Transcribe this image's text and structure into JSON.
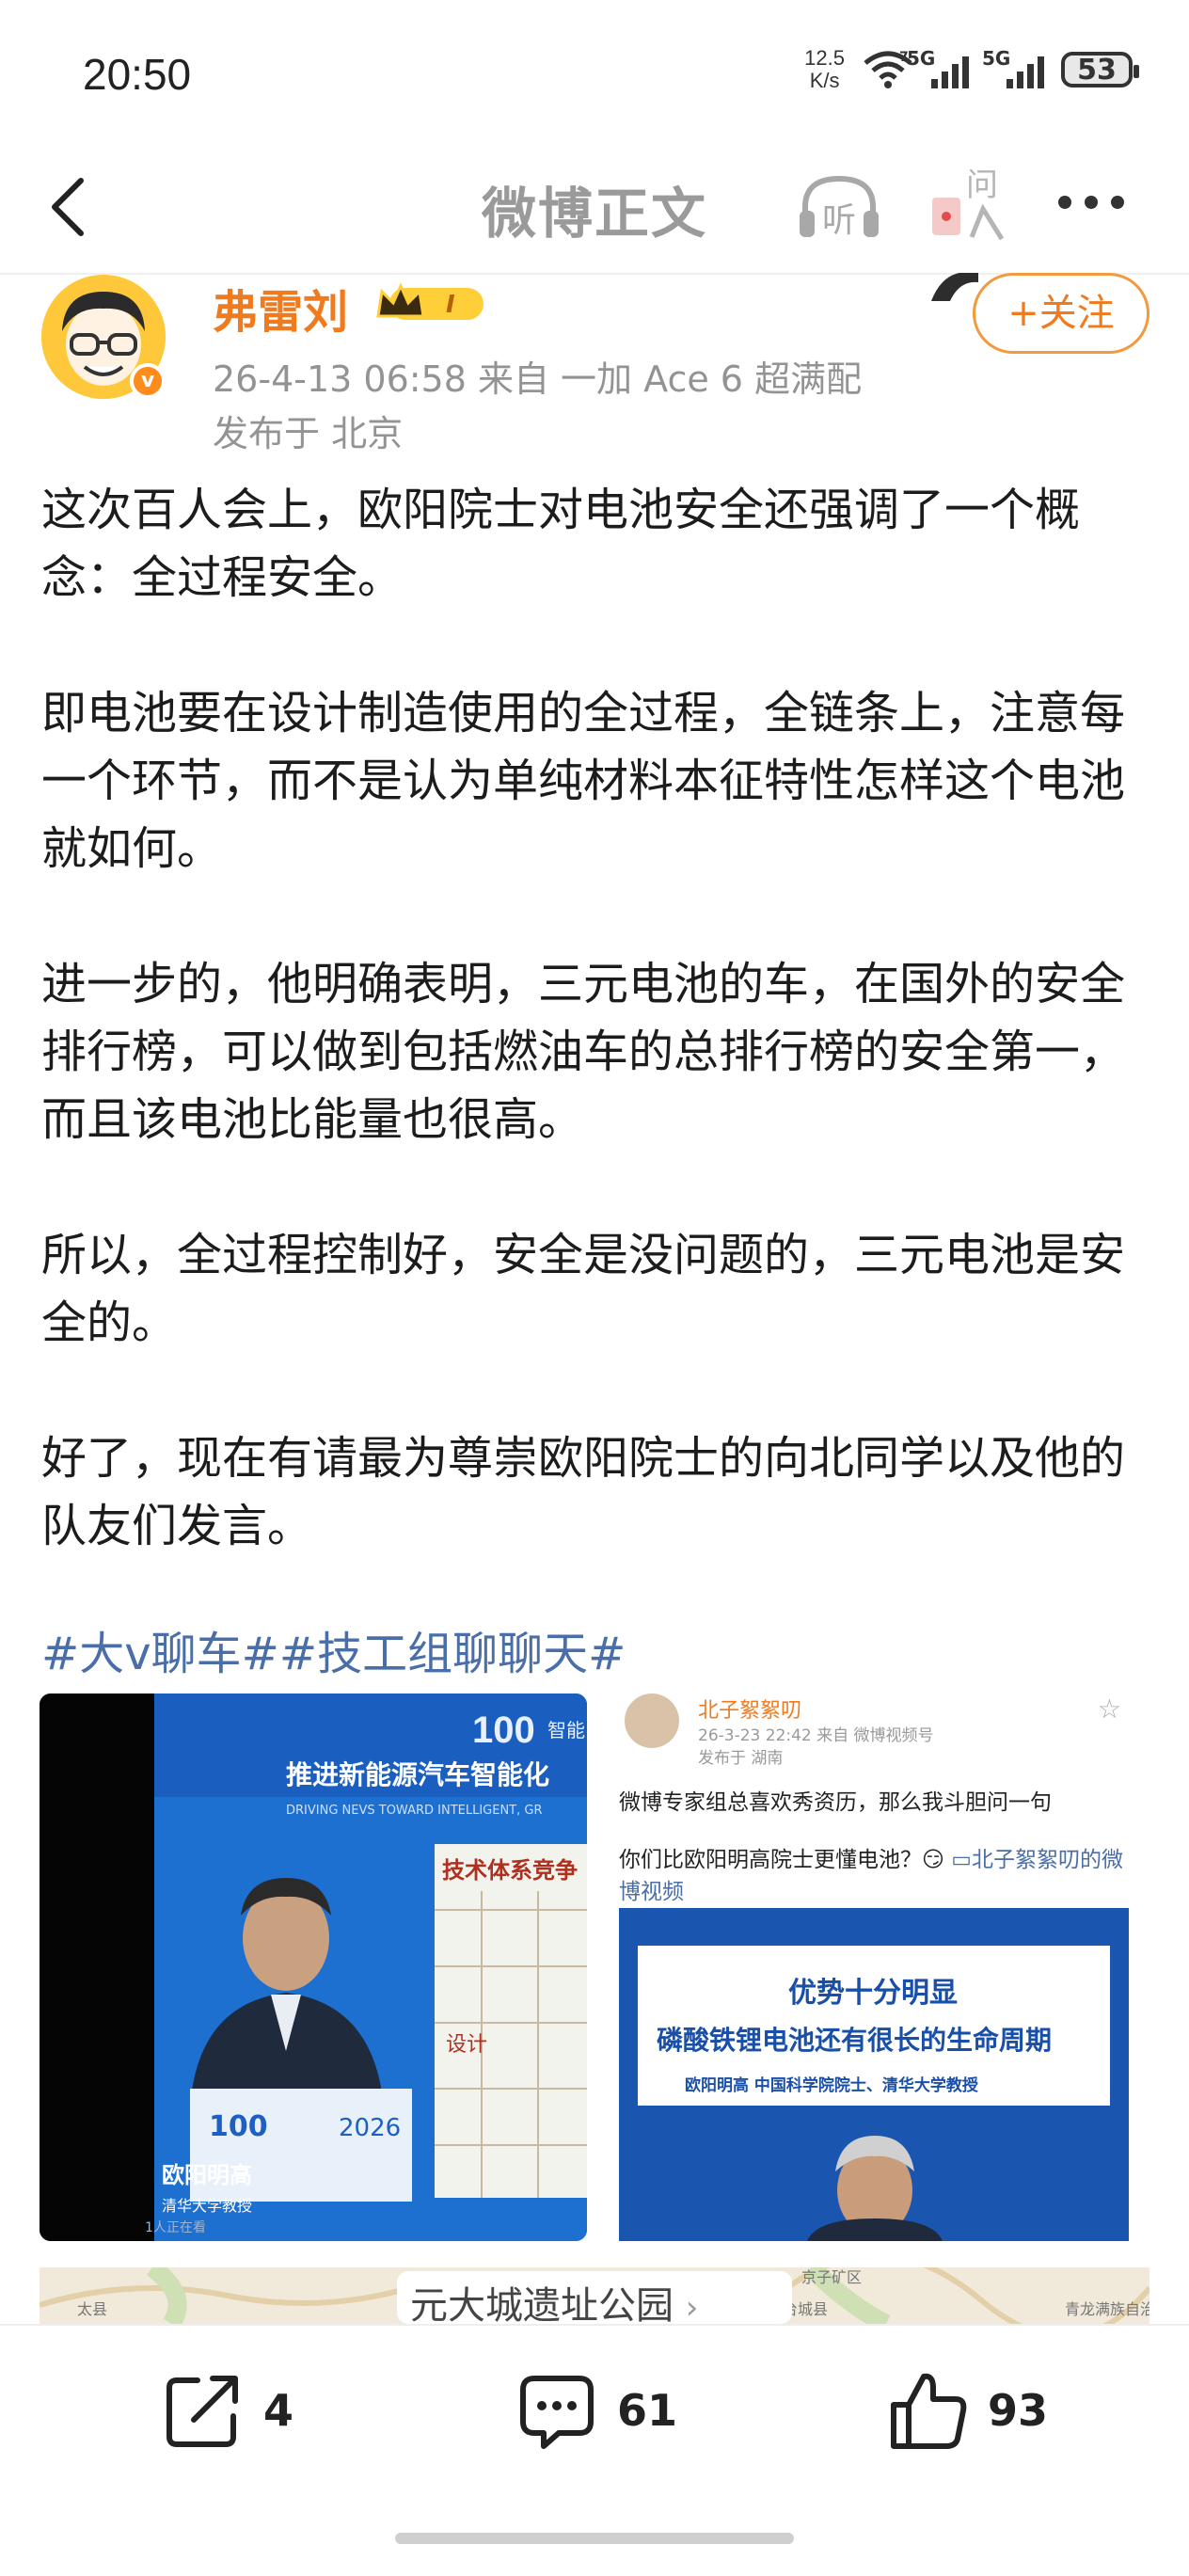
{
  "status_bar": {
    "time": "20:50",
    "net_speed_value": "12.5",
    "net_speed_unit": "K/s",
    "wifi_label": "7",
    "signal1_label": "5G",
    "signal2_label": "5G",
    "battery": "53"
  },
  "nav": {
    "title": "微博正文",
    "listen_icon": "headphones-listen-icon",
    "listen_label": "听",
    "ask_icon": "ask-icon",
    "ask_label": "问"
  },
  "author": {
    "name": "弗雷刘",
    "level_badge": "I",
    "meta_line": "26-4-13 06:58  来自 一加 Ace 6 超满配",
    "location": "发布于 北京",
    "follow_label": "+关注",
    "verified_mark": "v"
  },
  "post": {
    "paragraphs": [
      "这次百人会上，欧阳院士对电池安全还强调了一个概念：全过程安全。",
      "即电池要在设计制造使用的全过程，全链条上，注意每一个环节，而不是认为单纯材料本征特性怎样这个电池就如何。",
      "进一步的，他明确表明，三元电池的车，在国外的安全排行榜，可以做到包括燃油车的总排行榜的安全第一，而且该电池比能量也很高。",
      "所以，全过程控制好，安全是没问题的，三元电池是安全的。",
      "好了，现在有请最为尊崇欧阳院士的向北同学以及他的队友们发言。"
    ],
    "hashtags": "#大v聊车##技工组聊聊天#"
  },
  "video": {
    "logo": "100",
    "logo_suffix": "智能",
    "headline": "推进新能源汽车智能化",
    "headline_en": "DRIVING NEVS TOWARD INTELLIGENT, GR",
    "panel_title": "技术体系竞争",
    "panel_side": "设计",
    "podium_year": "2026",
    "speaker_name": "欧阳明高",
    "speaker_org": "清华大学教授",
    "viewers": "1人正在看"
  },
  "repost": {
    "name": "北子絮絮叨",
    "meta": "26-3-23 22:42  来自 微博视频号",
    "location": "发布于 湖南",
    "text1": "微博专家组总喜欢秀资历，那么我斗胆问一句",
    "text2": "你们比欧阳明高院士更懂电池？",
    "emoji": "😏",
    "link_text": "北子絮絮叨的微博视频",
    "img_title": "优势十分明显",
    "img_subtitle": "磷酸铁锂电池还有很长的生命周期",
    "img_caption": "欧阳明高   中国科学院院士、清华大学教授"
  },
  "map": {
    "label": "元大城遗址公园",
    "place1": "太县",
    "place2": "京子矿区",
    "place3": "台城县",
    "place4": "青龙满族自治县"
  },
  "actions": {
    "share_count": "4",
    "comment_count": "61",
    "like_count": "93"
  }
}
